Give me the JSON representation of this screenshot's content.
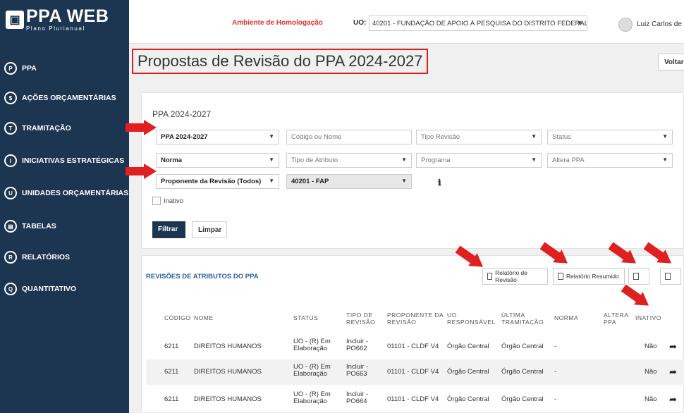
{
  "sidebar": {
    "logo_main": "PPA WEB",
    "logo_sub": "Plano Plurianual",
    "items": [
      {
        "label": "PPA",
        "icon": "P"
      },
      {
        "label": "AÇÕES ORÇAMENTÁRIAS",
        "icon": "$"
      },
      {
        "label": "TRAMITAÇÃO",
        "icon": "T"
      },
      {
        "label": "INICIATIVAS ESTRATÉGICAS",
        "icon": "I"
      },
      {
        "label": "UNIDADES ORÇAMENTÁRIAS",
        "icon": "U"
      },
      {
        "label": "TABELAS",
        "icon": "▤"
      },
      {
        "label": "RELATÓRIOS",
        "icon": "R"
      },
      {
        "label": "QUANTITATIVO",
        "icon": "Q"
      }
    ]
  },
  "topbar": {
    "environment": "Ambiente de Homologação",
    "uo_label": "UO:",
    "uo_value": "40201 - FUNDAÇÃO DE APOIO À PESQUISA DO DISTRITO FEDERAL",
    "user_name": "Luiz Carlos de ..."
  },
  "page": {
    "title": "Propostas de Revisão do PPA 2024-2027",
    "back_button": "Voltar"
  },
  "filters": {
    "heading": "PPA 2024-2027",
    "ppa": "PPA 2024-2027",
    "codigo_placeholder": "Código ou Nome",
    "tipo_revisao": "Tipo Revisão",
    "status": "Status",
    "norma": "Norma",
    "tipo_atributo": "Tipo de Atributo",
    "programa": "Programa",
    "altera_ppa": "Altera PPA",
    "proponente": "Proponente da Revisão (Todos)",
    "uo_filter": "40201 - FAP",
    "inativo": "Inativo",
    "filtrar": "Filtrar",
    "limpar": "Limpar"
  },
  "results": {
    "title": "REVISÕES DE ATRIBUTOS DO PPA",
    "btn_relatorio_revisao": "Relatório de Revisão",
    "btn_relatorio_resumido": "Relatório Resumido",
    "columns": [
      "CÓDIGO",
      "NOME",
      "STATUS",
      "TIPO DE REVISÃO",
      "PROPONENTE DA REVISÃO",
      "UO RESPONSÁVEL",
      "ÚLTIMA TRAMITAÇÃO",
      "NORMA",
      "ALTERA PPA",
      "INATIVO"
    ],
    "rows": [
      {
        "codigo": "6211",
        "nome": "DIREITOS HUMANOS",
        "status": "UO - (R) Em Elaboração",
        "tipo": "Incluir - PO662",
        "proponente": "01101 - CLDF V4",
        "uo": "Órgão Central",
        "tramitacao": "Órgão Central",
        "norma": "-",
        "inativo": "Não"
      },
      {
        "codigo": "6211",
        "nome": "DIREITOS HUMANOS",
        "status": "UO - (R) Em Elaboração",
        "tipo": "Incluir - PO663",
        "proponente": "01101 - CLDF V4",
        "uo": "Órgão Central",
        "tramitacao": "Órgão Central",
        "norma": "-",
        "inativo": "Não"
      },
      {
        "codigo": "6211",
        "nome": "DIREITOS HUMANOS",
        "status": "UO - (R) Em Elaboração",
        "tipo": "Incluir - PO664",
        "proponente": "01101 - CLDF V4",
        "uo": "Órgão Central",
        "tramitacao": "Órgão Central",
        "norma": "-",
        "inativo": "Não"
      }
    ]
  },
  "colors": {
    "sidebar": "#1c3550",
    "accent_red": "#e02020",
    "link_blue": "#2a6099"
  }
}
